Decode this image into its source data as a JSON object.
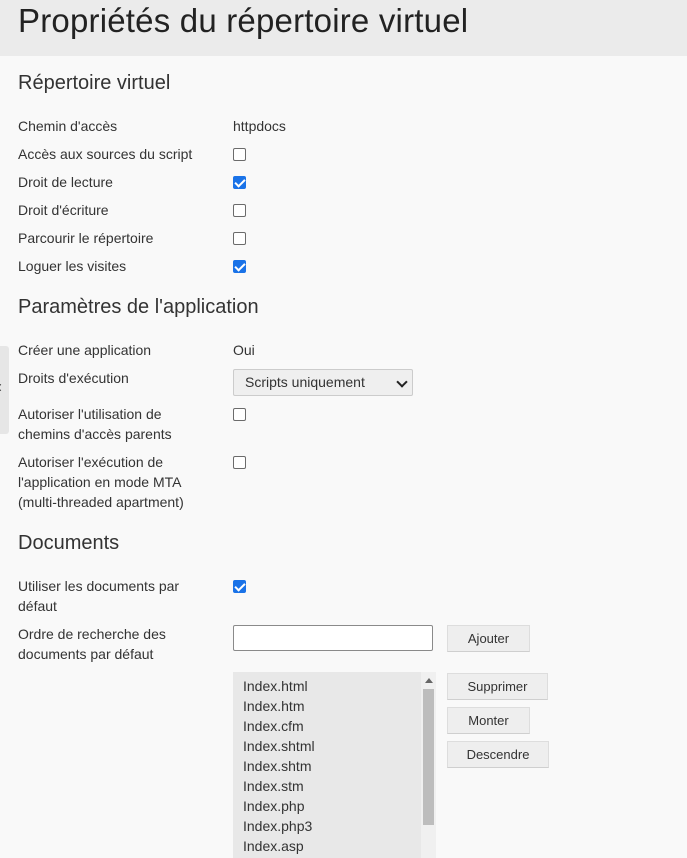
{
  "page_title": "Propriétés du répertoire virtuel",
  "sections": {
    "virtual_dir": {
      "title": "Répertoire virtuel",
      "path_label": "Chemin d'accès",
      "path_value": "httpdocs",
      "script_source_label": "Accès aux sources du script",
      "script_source_checked": false,
      "read_label": "Droit de lecture",
      "read_checked": true,
      "write_label": "Droit d'écriture",
      "write_checked": false,
      "browse_label": "Parcourir le répertoire",
      "browse_checked": false,
      "log_label": "Loguer les visites",
      "log_checked": true
    },
    "app": {
      "title": "Paramètres de l'application",
      "create_label": "Créer une application",
      "create_value": "Oui",
      "exec_label": "Droits d'exécution",
      "exec_value": "Scripts uniquement",
      "parent_paths_label": "Autoriser l'utilisation de chemins d'accès parents",
      "parent_paths_checked": false,
      "mta_label": "Autoriser l'exécution de l'application en mode MTA (multi-threaded apartment)",
      "mta_checked": false
    },
    "documents": {
      "title": "Documents",
      "use_default_label": "Utiliser les documents par défaut",
      "use_default_checked": true,
      "search_order_label": "Ordre de recherche des documents par défaut",
      "search_input_value": "",
      "add_button": "Ajouter",
      "remove_button": "Supprimer",
      "up_button": "Monter",
      "down_button": "Descendre",
      "documents": [
        "Index.html",
        "Index.htm",
        "Index.cfm",
        "Index.shtml",
        "Index.shtm",
        "Index.stm",
        "Index.php",
        "Index.php3",
        "Index.asp"
      ]
    }
  }
}
